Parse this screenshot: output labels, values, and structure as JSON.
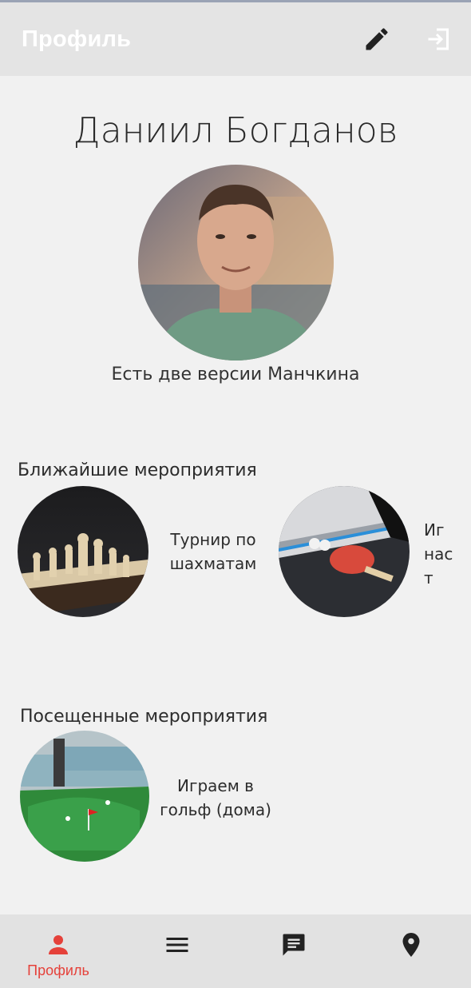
{
  "appbar": {
    "title": "Профиль",
    "edit_icon": "pencil-icon",
    "logout_icon": "logout-icon"
  },
  "profile": {
    "name": "Даниил Богданов",
    "status": "Есть две версии Манчкина"
  },
  "upcoming": {
    "title": "Ближайшие мероприятия",
    "events": [
      {
        "label": "Турнир по\nшахматам",
        "image": "chess"
      },
      {
        "label": "Иг\nнас\nт",
        "image": "ping-pong"
      }
    ]
  },
  "visited": {
    "title": "Посещенные мероприятия",
    "events": [
      {
        "label": "Играем в\nгольф (дома)",
        "image": "mini-golf"
      }
    ]
  },
  "nav": {
    "items": [
      {
        "label": "Профиль",
        "icon": "person-icon",
        "active": true
      },
      {
        "label": "",
        "icon": "menu-icon"
      },
      {
        "label": "",
        "icon": "chat-icon"
      },
      {
        "label": "",
        "icon": "location-pin-icon"
      }
    ]
  },
  "colors": {
    "accent": "#e5413a",
    "background": "#f1f1f1",
    "appbar": "#e4e4e4",
    "icon_dark": "#222222"
  }
}
